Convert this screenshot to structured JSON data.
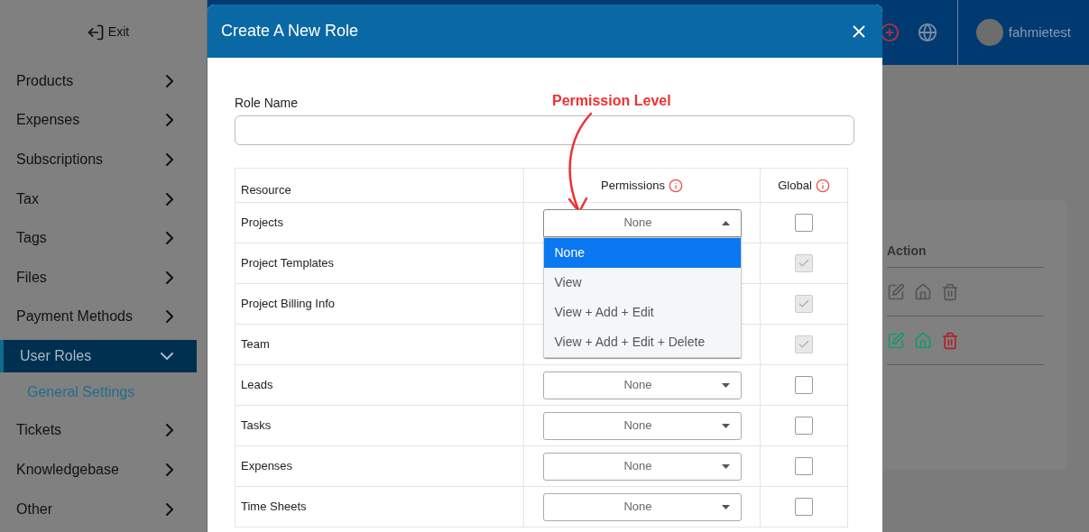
{
  "sidebar": {
    "exit": "Exit",
    "items": [
      {
        "label": "Products",
        "expanded": false,
        "selected": false
      },
      {
        "label": "Expenses",
        "expanded": false,
        "selected": false
      },
      {
        "label": "Subscriptions",
        "expanded": false,
        "selected": false
      },
      {
        "label": "Tax",
        "expanded": false,
        "selected": false
      },
      {
        "label": "Tags",
        "expanded": false,
        "selected": false
      },
      {
        "label": "Files",
        "expanded": false,
        "selected": false
      },
      {
        "label": "Payment Methods",
        "expanded": false,
        "selected": false
      },
      {
        "label": "User Roles",
        "expanded": true,
        "selected": true,
        "children": [
          {
            "label": "General Settings"
          }
        ]
      },
      {
        "label": "Tickets",
        "expanded": false,
        "selected": false
      },
      {
        "label": "Knowledgebase",
        "expanded": false,
        "selected": false
      },
      {
        "label": "Other",
        "expanded": false,
        "selected": false
      }
    ]
  },
  "topbar": {
    "username": "fahmietest"
  },
  "background_table": {
    "columns": [
      "Action"
    ],
    "rows": [
      {
        "active": false
      },
      {
        "active": true
      }
    ]
  },
  "modal": {
    "title": "Create A New Role",
    "role_name": {
      "label": "Role Name"
    },
    "annotation": "Permission Level",
    "table": {
      "columns": [
        "Resource",
        "Permissions",
        "Global"
      ],
      "rows": [
        {
          "resource": "Projects",
          "permission": "None",
          "open": true,
          "global": {
            "checked": false,
            "disabled": false
          }
        },
        {
          "resource": "Project Templates",
          "global": {
            "checked": true,
            "disabled": true
          }
        },
        {
          "resource": "Project Billing Info",
          "global": {
            "checked": true,
            "disabled": true
          }
        },
        {
          "resource": "Team",
          "global": {
            "checked": true,
            "disabled": true
          }
        },
        {
          "resource": "Leads",
          "permission": "None",
          "global": {
            "checked": false,
            "disabled": false
          }
        },
        {
          "resource": "Tasks",
          "permission": "None",
          "global": {
            "checked": false,
            "disabled": false
          }
        },
        {
          "resource": "Expenses",
          "permission": "None",
          "global": {
            "checked": false,
            "disabled": false
          }
        },
        {
          "resource": "Time Sheets",
          "permission": "None",
          "global": {
            "checked": false,
            "disabled": false
          }
        }
      ]
    },
    "dropdown": {
      "options": [
        {
          "label": "None",
          "selected": true
        },
        {
          "label": "View",
          "selected": false
        },
        {
          "label": "View + Add + Edit",
          "selected": false
        },
        {
          "label": "View + Add + Edit + Delete",
          "selected": false
        }
      ]
    }
  }
}
